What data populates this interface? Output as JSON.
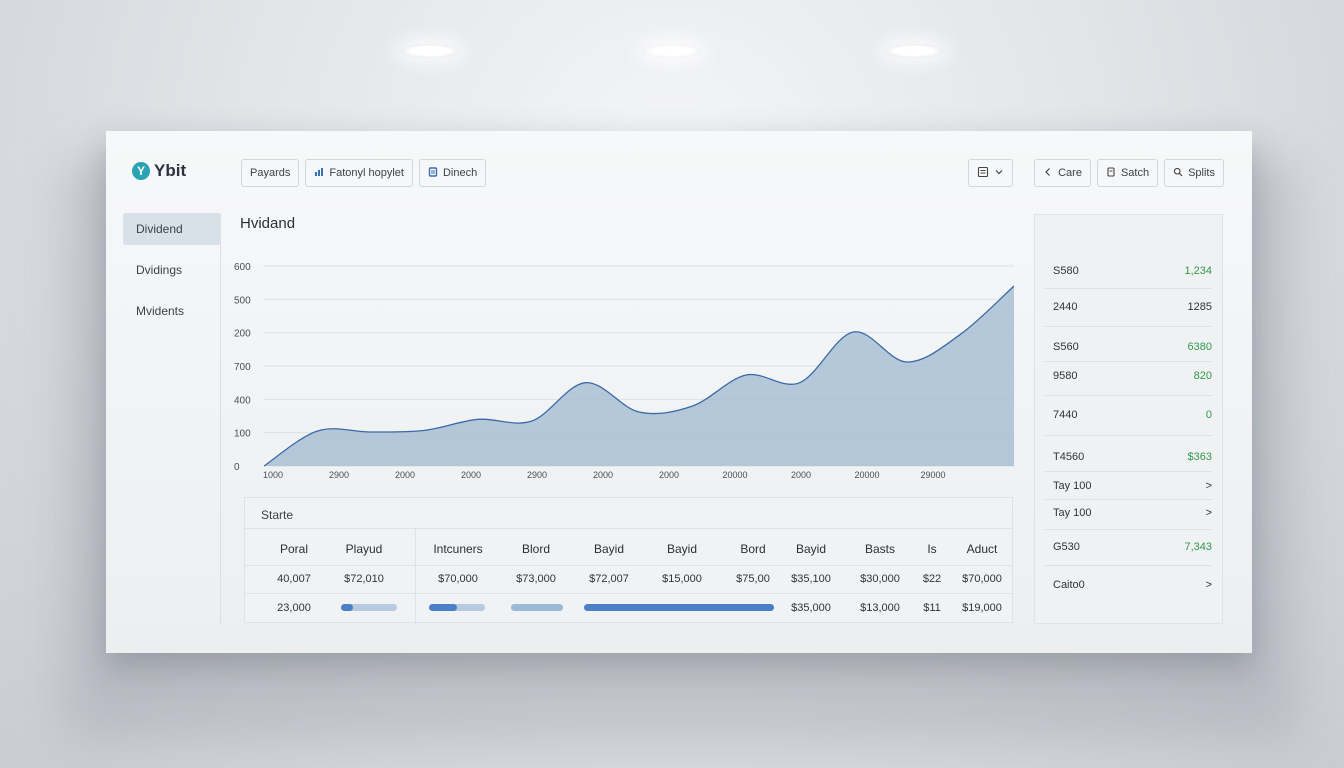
{
  "app": {
    "logo_letter": "Y",
    "name": "Ybit"
  },
  "sidebar": {
    "items": [
      {
        "label": "Dividend",
        "active": true
      },
      {
        "label": "Dvidings",
        "active": false
      },
      {
        "label": "Mvidents",
        "active": false
      }
    ]
  },
  "toolbar": {
    "buttons": [
      {
        "label": "Payards",
        "icon": ""
      },
      {
        "label": "Fatonyl hopylet",
        "icon": "chart-icon"
      },
      {
        "label": "Dinech",
        "icon": "doc-icon"
      }
    ],
    "menu_icon": "list-icon",
    "right_buttons": [
      {
        "label": "Care",
        "icon": "chevron-left-icon"
      },
      {
        "label": "Satch",
        "icon": "doc-icon"
      },
      {
        "label": "Splits",
        "icon": "search-icon"
      }
    ]
  },
  "main": {
    "title": "Hvidand"
  },
  "chart_data": {
    "type": "area",
    "y_tick_labels": [
      "600",
      "500",
      "200",
      "700",
      "400",
      "100",
      "0"
    ],
    "x_tick_labels": [
      "1000",
      "2900",
      "2000",
      "2000",
      "2900",
      "2000",
      "2000",
      "20000",
      "2000",
      "20000",
      "29000"
    ],
    "series": [
      {
        "values": [
          0,
          105,
          102,
          107,
          140,
          135,
          250,
          162,
          180,
          273,
          250,
          402,
          312,
          395,
          540
        ]
      }
    ],
    "ylim": [
      0,
      600
    ],
    "grid": true,
    "fill_color": "#a9bfd4",
    "line_color": "#3a6aa8"
  },
  "table": {
    "title": "Starte",
    "headers": [
      "Poral",
      "Playud",
      "Intcuners",
      "Blord",
      "Bayid",
      "Bayid",
      "Bord",
      "Bayid",
      "Basts",
      "Is",
      "Aduct"
    ],
    "row1": [
      "40,007",
      "$72,010",
      "$70,000",
      "$73,000",
      "$72,007",
      "$15,000",
      "$75,00",
      "$35,100",
      "$30,000",
      "$22",
      "$70,000"
    ],
    "row2_first": "23,000",
    "row2_bars": [
      0.22,
      0.5,
      1.0,
      1.0
    ],
    "row2_tail": [
      "$35,000",
      "$13,000",
      "$11",
      "$19,000"
    ]
  },
  "stats": [
    {
      "k": "S580",
      "v": "1,234",
      "green": true
    },
    {
      "k": "2440",
      "v": "1285",
      "green": false
    },
    {
      "k": "S560",
      "v": "6380",
      "green": true
    },
    {
      "k": "9580",
      "v": "820",
      "green": true
    },
    {
      "k": "7440",
      "v": "0",
      "green": true
    },
    {
      "k": "T4560",
      "v": "$363",
      "green": true
    },
    {
      "k": "Tay 100",
      "v": ">",
      "green": false
    },
    {
      "k": "Tay 100",
      "v": ">",
      "green": false
    },
    {
      "k": "G530",
      "v": "7,343",
      "green": true
    },
    {
      "k": "Caito0",
      "v": ">",
      "green": false
    }
  ],
  "colors": {
    "accent": "#3a6fb5",
    "positive": "#2f9a4c",
    "logo": "#2aa3b4"
  }
}
